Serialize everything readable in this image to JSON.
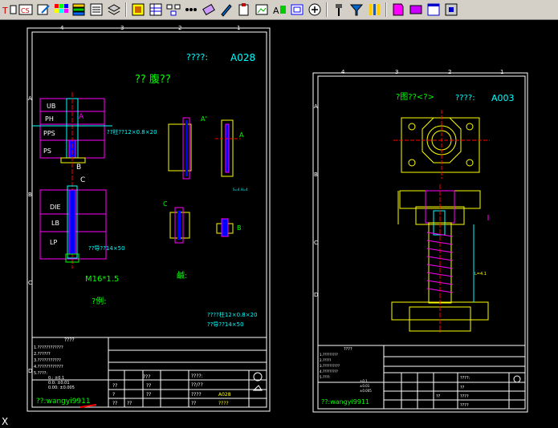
{
  "toolbar": {
    "icons": [
      "text-style-icon",
      "text-format-icon",
      "edit-text-icon",
      "color-grid-icon",
      "layer-icon",
      "list-icon",
      "stack-icon",
      "block-icon",
      "table-icon",
      "tree-icon",
      "dots-icon",
      "eraser-icon",
      "pen-icon",
      "paste-icon",
      "image-icon",
      "ocr-icon",
      "frame-icon",
      "add-icon",
      "hammer-icon",
      "filter-icon",
      "pipe-icon",
      "page-icon",
      "rect-icon",
      "window-icon",
      "end-icon"
    ]
  },
  "left_sheet": {
    "title_code": "????:",
    "title_id": "A028",
    "heading": "?? 腹??",
    "ruler_top": [
      "4",
      "3",
      "2",
      "1"
    ],
    "ruler_side": [
      "A",
      "B",
      "C",
      "D"
    ],
    "plates_top": [
      "UB",
      "PH",
      "PPS",
      "PS"
    ],
    "plates_bottom": [
      "DIE",
      "LB",
      "LP"
    ],
    "label_a": "A",
    "label_b": "B",
    "label_c": "C",
    "callout_1": "??柱??12×0.8×20",
    "callout_2": "??导??14×50",
    "thread": "M16*1.5",
    "note_left": "?例:",
    "note_center": "鹹:",
    "spec_line1": "????柱12×0.8×20",
    "spec_line2": "??导??14×50",
    "view_a": "A'",
    "view_a2": "A",
    "view_c": "C",
    "view_b": "B",
    "small_note": "S=4 H=4",
    "notes_title": "????",
    "notes": [
      "1.????????????",
      "2.??????",
      "3.???????????",
      "4.????????????",
      "5.????:"
    ],
    "tolerances": [
      "0.:   ±0.1",
      "0.0:  ±0.01",
      "0.00: ±0.005"
    ],
    "tb_cells": [
      "???",
      "??",
      "?"
    ],
    "tb_labels": [
      "??",
      "??",
      "??",
      "??"
    ],
    "tb_fields": [
      "????:",
      "??/??",
      "????",
      "A028",
      "??",
      "????"
    ],
    "author": "??:wangyi9911"
  },
  "right_sheet": {
    "title_left": "?图??<?>",
    "title_code": "????:",
    "title_id": "A003",
    "ruler_top": [
      "4",
      "3",
      "2",
      "1"
    ],
    "ruler_side": [
      "A",
      "B",
      "C",
      "D"
    ],
    "dim_label": "L=4.1",
    "notes_title": "????",
    "notes": [
      "1.?????????",
      "2.?????",
      "3.??????????",
      "4.?????????",
      "5.????:"
    ],
    "tolerances": [
      "±0.1",
      "±0.01",
      "±0.005"
    ],
    "tb_fields": [
      "????:",
      "??",
      "????",
      "??",
      "????"
    ],
    "author": "??:wangyi9911"
  },
  "corner": "X",
  "colors": {
    "bg": "#000000",
    "border": "#ffffff",
    "cyan": "#00ffff",
    "green": "#00ff00",
    "yellow": "#ffff00",
    "magenta": "#ff00ff",
    "red": "#ff0000",
    "blue": "#0000ff"
  }
}
